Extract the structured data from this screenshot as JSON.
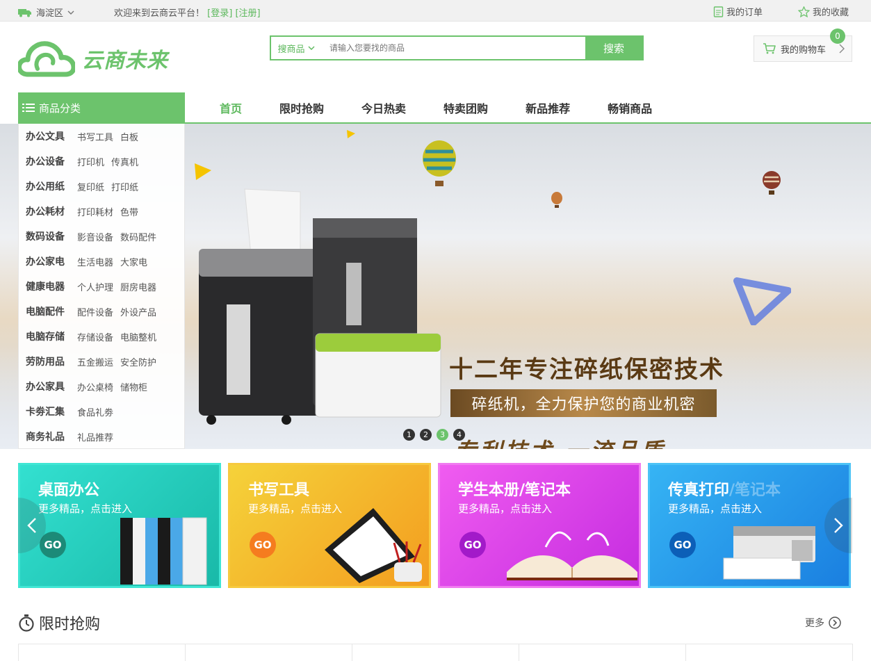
{
  "topbar": {
    "location": "海淀区",
    "welcome": "欢迎来到云商云平台！",
    "login": "[登录]",
    "register": "[注册]",
    "my_orders": "我的订单",
    "my_favorites": "我的收藏"
  },
  "header": {
    "brand": "云商未来",
    "search_scope": "搜商品",
    "search_placeholder": "请输入您要找的商品",
    "search_button": "搜索",
    "cart_label": "我的购物车",
    "cart_count": "0"
  },
  "nav": {
    "category_button": "商品分类",
    "items": [
      {
        "label": "首页",
        "active": true
      },
      {
        "label": "限时抢购",
        "active": false
      },
      {
        "label": "今日热卖",
        "active": false
      },
      {
        "label": "特卖团购",
        "active": false
      },
      {
        "label": "新品推荐",
        "active": false
      },
      {
        "label": "畅销商品",
        "active": false
      }
    ]
  },
  "categories": [
    {
      "main": "办公文具",
      "subs": [
        "书写工具",
        "白板"
      ]
    },
    {
      "main": "办公设备",
      "subs": [
        "打印机",
        "传真机"
      ]
    },
    {
      "main": "办公用纸",
      "subs": [
        "复印纸",
        "打印纸"
      ]
    },
    {
      "main": "办公耗材",
      "subs": [
        "打印耗材",
        "色带"
      ]
    },
    {
      "main": "数码设备",
      "subs": [
        "影音设备",
        "数码配件"
      ]
    },
    {
      "main": "办公家电",
      "subs": [
        "生活电器",
        "大家电"
      ]
    },
    {
      "main": "健康电器",
      "subs": [
        "个人护理",
        "厨房电器"
      ]
    },
    {
      "main": "电脑配件",
      "subs": [
        "配件设备",
        "外设产品"
      ]
    },
    {
      "main": "电脑存储",
      "subs": [
        "存储设备",
        "电脑整机"
      ]
    },
    {
      "main": "劳防用品",
      "subs": [
        "五金搬运",
        "安全防护"
      ]
    },
    {
      "main": "办公家具",
      "subs": [
        "办公桌椅",
        "储物柜"
      ]
    },
    {
      "main": "卡劵汇集",
      "subs": [
        "食品礼劵"
      ]
    },
    {
      "main": "商务礼品",
      "subs": [
        "礼品推荐"
      ]
    }
  ],
  "banner": {
    "headline": "十二年专注碎纸保密技术",
    "subline": "碎纸机，全力保护您的商业机密",
    "tagline": "专利技术 一流品质",
    "dots": [
      "1",
      "2",
      "3",
      "4"
    ],
    "active_dot": 2
  },
  "promos": [
    {
      "title": "桌面办公",
      "sub": "更多精品，点击进入",
      "go": "GO",
      "color": "#2ed8c8",
      "go_color": "#1c8a78"
    },
    {
      "title": "书写工具",
      "sub": "更多精品，点击进入",
      "go": "GO",
      "color": "#f5b82a",
      "go_color": "#f57c1f"
    },
    {
      "title": "学生本册/笔记本",
      "sub": "更多精品，点击进入",
      "go": "GO",
      "color": "#e34fe6",
      "go_color": "#a21ac9"
    },
    {
      "title": "传真打印",
      "ghost": "/笔记本",
      "sub": "更多精品，点击进入",
      "go": "GO",
      "color": "#2aa3f0",
      "go_color": "#0c5fb8"
    }
  ],
  "section": {
    "title": "限时抢购",
    "more": "更多"
  },
  "colors": {
    "brand_green": "#6cc36c",
    "text_dark": "#333333"
  }
}
